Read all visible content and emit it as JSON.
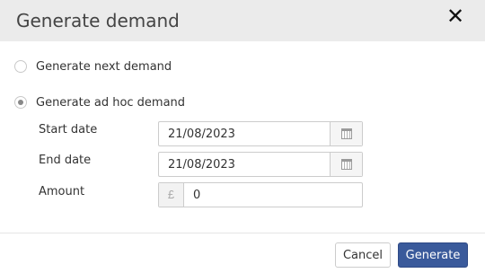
{
  "dialog": {
    "title": "Generate demand",
    "close_symbol": "✕"
  },
  "options": [
    {
      "label": "Generate next demand",
      "checked": false
    },
    {
      "label": "Generate ad hoc demand",
      "checked": true
    }
  ],
  "fields": {
    "start_date": {
      "label": "Start date",
      "value": "21/08/2023",
      "icon": "calendar-icon"
    },
    "end_date": {
      "label": "End date",
      "value": "21/08/2023",
      "icon": "calendar-icon"
    },
    "amount": {
      "label": "Amount",
      "currency": "£",
      "value": "0"
    }
  },
  "buttons": {
    "cancel": "Cancel",
    "generate": "Generate"
  },
  "colors": {
    "header_bg": "#ebebeb",
    "primary": "#3a5a9b"
  }
}
